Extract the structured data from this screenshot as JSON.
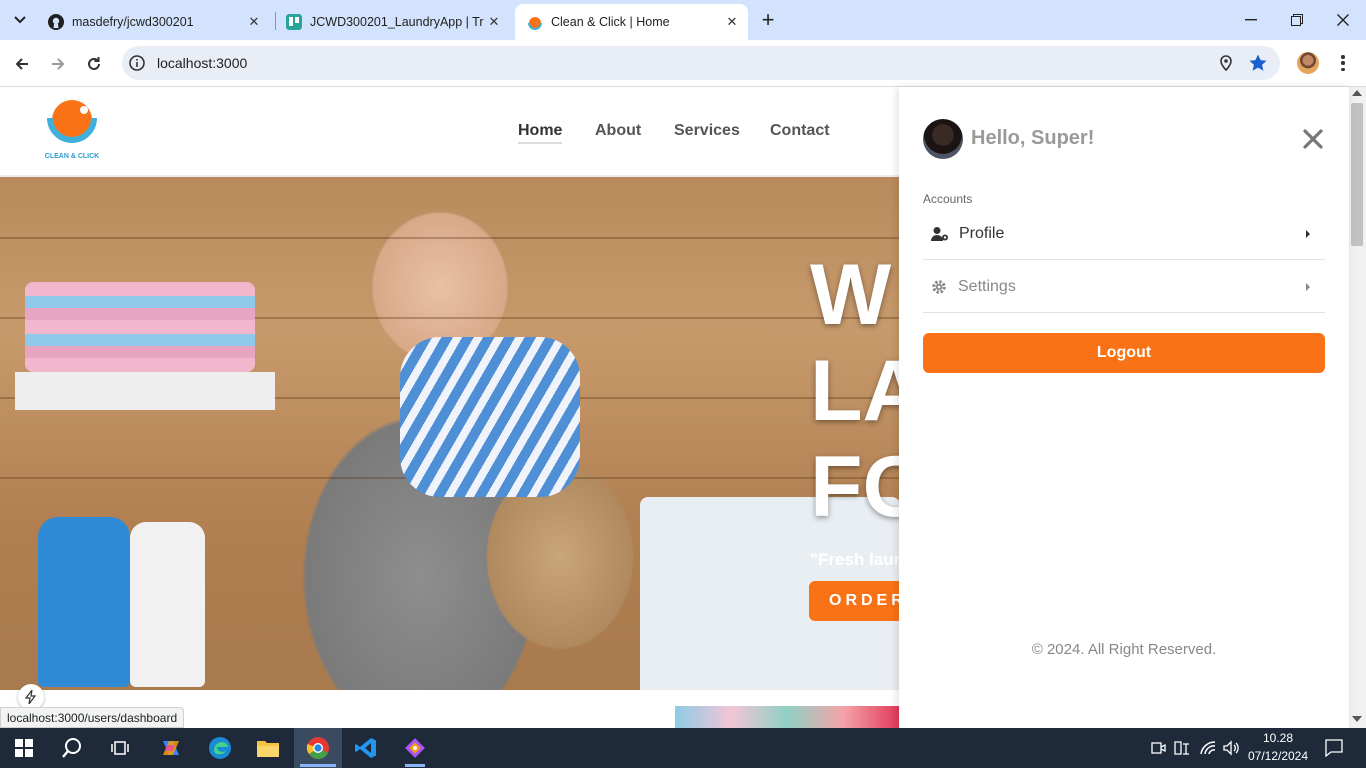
{
  "browser": {
    "tabs": [
      {
        "title": "masdefry/jcwd300201",
        "favicon": "github-icon"
      },
      {
        "title": "JCWD300201_LaundryApp | Trello",
        "favicon": "trello-icon"
      },
      {
        "title": "Clean & Click | Home",
        "favicon": "clean-click-icon"
      }
    ],
    "new_tab_label": "+",
    "url": "localhost:3000",
    "status_url": "localhost:3000/users/dashboard"
  },
  "site": {
    "logo_text": "CLEAN & CLICK",
    "nav": [
      "Home",
      "About",
      "Services",
      "Contact"
    ],
    "hero": {
      "title_lines": [
        "W",
        "LA",
        "FO"
      ],
      "tagline": "\"Fresh laun",
      "cta_label": "ORDER"
    }
  },
  "panel": {
    "greeting": "Hello, Super!",
    "section_label": "Accounts",
    "items": [
      {
        "label": "Profile",
        "icon": "user-gear-icon"
      },
      {
        "label": "Settings",
        "icon": "gear-icon"
      }
    ],
    "logout_label": "Logout",
    "footer": "© 2024. All Right Reserved."
  },
  "taskbar": {
    "time": "10.28",
    "date": "07/12/2024"
  },
  "colors": {
    "accent": "#f97316",
    "tabstrip": "#d3e3fd",
    "taskbar": "#1e2a3a"
  }
}
